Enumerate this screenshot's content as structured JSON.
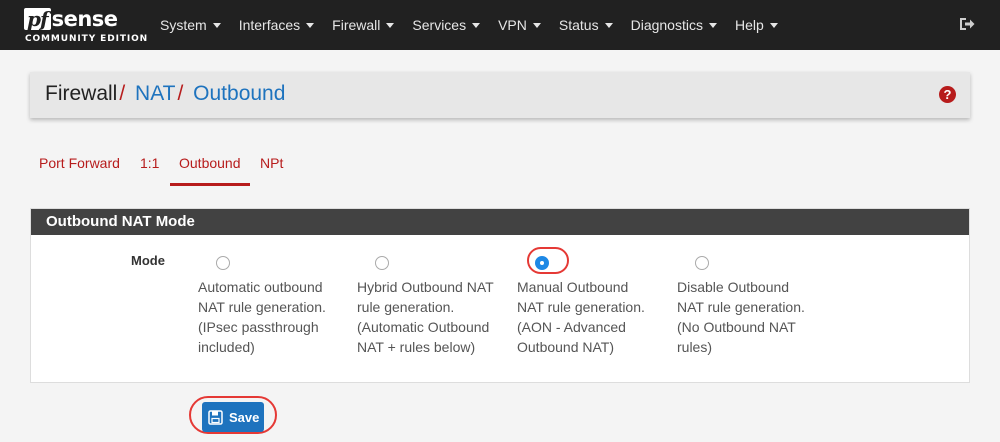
{
  "brand": {
    "name_pf": "pf",
    "name_sense": "sense",
    "edition": "COMMUNITY EDITION"
  },
  "nav": {
    "items": [
      {
        "label": "System"
      },
      {
        "label": "Interfaces"
      },
      {
        "label": "Firewall"
      },
      {
        "label": "Services"
      },
      {
        "label": "VPN"
      },
      {
        "label": "Status"
      },
      {
        "label": "Diagnostics"
      },
      {
        "label": "Help"
      }
    ],
    "logout_icon": "sign-out-icon"
  },
  "breadcrumb": {
    "root": "Firewall",
    "separator": "/",
    "level1": "NAT",
    "level2": "Outbound",
    "help_icon": "question-circle-icon",
    "help_glyph": "?"
  },
  "tabs": [
    {
      "label": "Port Forward",
      "active": false
    },
    {
      "label": "1:1",
      "active": false
    },
    {
      "label": "Outbound",
      "active": true
    },
    {
      "label": "NPt",
      "active": false
    }
  ],
  "panel": {
    "title": "Outbound NAT Mode",
    "mode_label": "Mode",
    "options": [
      {
        "text": "Automatic outbound NAT rule generation. (IPsec passthrough included)",
        "checked": false
      },
      {
        "text": "Hybrid Outbound NAT rule generation. (Automatic Outbound NAT + rules below)",
        "checked": false
      },
      {
        "text": "Manual Outbound NAT rule generation. (AON - Advanced Outbound NAT)",
        "checked": true
      },
      {
        "text": "Disable Outbound NAT rule generation. (No Outbound NAT rules)",
        "checked": false
      }
    ]
  },
  "save": {
    "label": "Save",
    "icon": "floppy-disk-icon"
  },
  "colors": {
    "navbar": "#212121",
    "accent_red": "#b71c1c",
    "link_blue": "#1e73be",
    "panel_heading": "#424242",
    "annotation_red": "#e53935"
  }
}
